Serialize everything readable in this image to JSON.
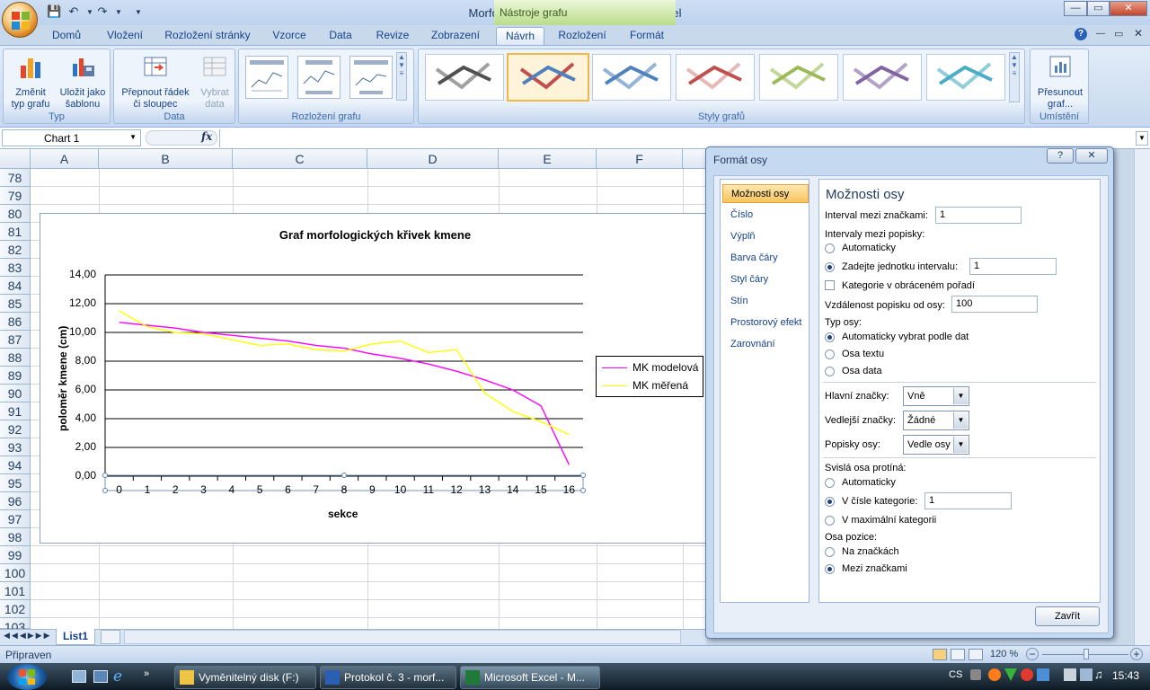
{
  "window": {
    "title": "Morfologie kmene excel - Microsoft Excel",
    "context_tab": "Nástroje grafu"
  },
  "tabs": [
    "Domů",
    "Vložení",
    "Rozložení stránky",
    "Vzorce",
    "Data",
    "Revize",
    "Zobrazení",
    "Návrh",
    "Rozložení",
    "Formát"
  ],
  "ribbon": {
    "typ": {
      "label": "Typ",
      "b1": "Změnit",
      "b1b": "typ grafu",
      "b2": "Uložit jako",
      "b2b": "šablonu"
    },
    "data": {
      "label": "Data",
      "b1": "Přepnout řádek",
      "b1b": "či sloupec",
      "b2": "Vybrat",
      "b2b": "data"
    },
    "layout": {
      "label": "Rozložení grafu"
    },
    "styles": {
      "label": "Styly grafů"
    },
    "place": {
      "label": "Umístění",
      "b1": "Přesunout",
      "b1b": "graf..."
    }
  },
  "formula_bar": {
    "name_box": "Chart 1",
    "fx": "fx"
  },
  "columns": [
    "A",
    "B",
    "C",
    "D",
    "E",
    "F"
  ],
  "rows": [
    "78",
    "79",
    "80",
    "81",
    "82",
    "83",
    "84",
    "85",
    "86",
    "87",
    "88",
    "89",
    "90",
    "91",
    "92",
    "93",
    "94",
    "95",
    "96",
    "97",
    "98",
    "99",
    "100",
    "101",
    "102",
    "103"
  ],
  "colors": {
    "mk_model": "#ff00ff",
    "mk_mereni": "#ffff00"
  },
  "chart_data": {
    "type": "line",
    "title": "Graf morfologických křivek kmene",
    "xlabel": "sekce",
    "ylabel": "poloměr kmene (cm)",
    "ylim": [
      0,
      14
    ],
    "yticks": [
      "0,00",
      "2,00",
      "4,00",
      "6,00",
      "8,00",
      "10,00",
      "12,00",
      "14,00"
    ],
    "categories": [
      "0",
      "1",
      "2",
      "3",
      "4",
      "5",
      "6",
      "7",
      "8",
      "9",
      "10",
      "11",
      "12",
      "13",
      "14",
      "15",
      "16"
    ],
    "legend_position": "right",
    "series": [
      {
        "name": "MK modelová",
        "values": [
          10.7,
          10.5,
          10.3,
          10.0,
          9.8,
          9.6,
          9.4,
          9.1,
          8.9,
          8.5,
          8.2,
          7.8,
          7.3,
          6.7,
          6.0,
          4.9,
          0.8
        ]
      },
      {
        "name": "MK měřená",
        "values": [
          11.5,
          10.4,
          10.0,
          9.9,
          9.5,
          9.1,
          9.2,
          8.8,
          8.7,
          9.2,
          9.4,
          8.6,
          8.8,
          5.8,
          4.5,
          3.8,
          2.9
        ]
      }
    ]
  },
  "sheet_tab": "List1",
  "status": {
    "left": "Připraven",
    "zoom": "120 %"
  },
  "taskbar": {
    "t1": "Vyměnitelný disk (F:)",
    "t2": "Protokol č. 3 - morf...",
    "t3": "Microsoft Excel - M...",
    "lang": "CS",
    "time": "15:43"
  },
  "dialog": {
    "title": "Formát osy",
    "nav": [
      "Možnosti osy",
      "Číslo",
      "Výplň",
      "Barva čáry",
      "Styl čáry",
      "Stín",
      "Prostorový efekt",
      "Zarovnání"
    ],
    "heading": "Možnosti osy",
    "interval_label": "Interval mezi značkami:",
    "interval_value": "1",
    "label_interval": "Intervaly mezi popisky:",
    "auto": "Automaticky",
    "unit_label": "Zadejte jednotku intervalu:",
    "unit_value": "1",
    "reverse": "Kategorie v obráceném pořadí",
    "distance_label": "Vzdálenost popisku od osy:",
    "distance_value": "100",
    "axis_type": "Typ osy:",
    "axis_auto": "Automaticky vybrat podle dat",
    "axis_text": "Osa textu",
    "axis_date": "Osa data",
    "major_label": "Hlavní značky:",
    "major_value": "Vně",
    "minor_label": "Vedlejší značky:",
    "minor_value": "Žádné",
    "axislbl_label": "Popisky osy:",
    "axislbl_value": "Vedle osy",
    "cross_label": "Svislá osa protíná:",
    "cross_auto": "Automaticky",
    "cross_cat": "V čísle kategorie:",
    "cross_cat_value": "1",
    "cross_max": "V maximální kategorii",
    "pos_label": "Osa pozice:",
    "pos_on": "Na značkách",
    "pos_between": "Mezi značkami",
    "close": "Zavřít"
  }
}
